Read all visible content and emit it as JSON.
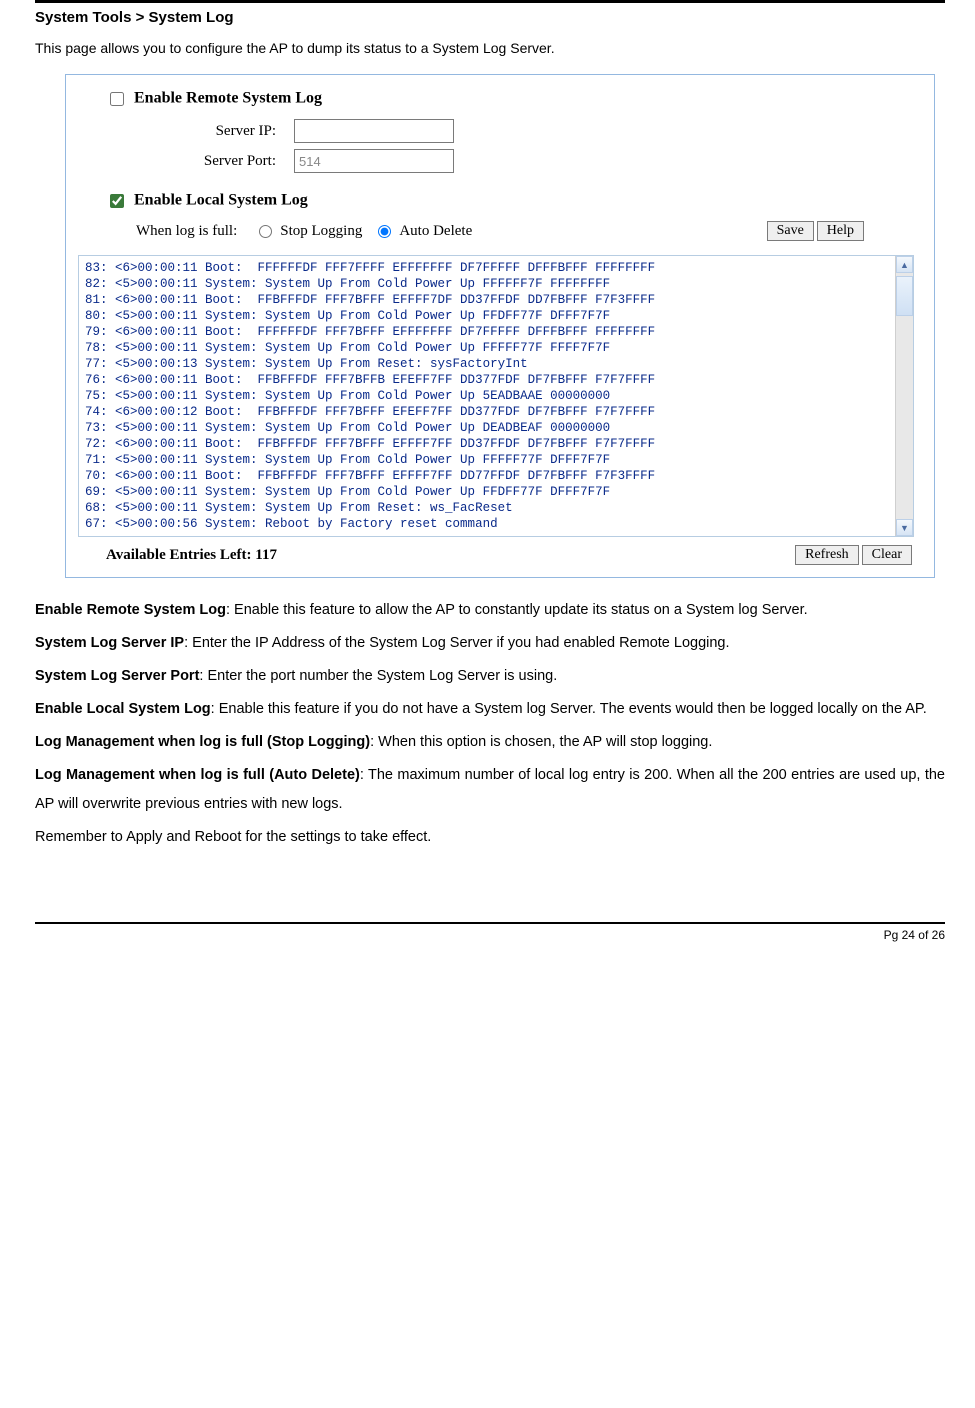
{
  "breadcrumb": "System Tools > System Log",
  "intro": "This page allows you to configure the AP to dump its status to a System Log Server.",
  "remote": {
    "heading": "Enable Remote System Log",
    "checked": false,
    "server_ip_label": "Server IP:",
    "server_ip_value": "",
    "server_port_label": "Server Port:",
    "server_port_value": "514"
  },
  "local": {
    "heading": "Enable Local System Log",
    "checked": true,
    "when_full_label": "When log is full:",
    "opt_stop": "Stop Logging",
    "opt_auto": "Auto Delete",
    "selected": "auto"
  },
  "buttons": {
    "save": "Save",
    "help": "Help",
    "refresh": "Refresh",
    "clear": "Clear"
  },
  "log_lines": [
    "83: <6>00:00:11 Boot:  FFFFFFDF FFF7FFFF EFFFFFFF DF7FFFFF DFFFBFFF FFFFFFFF",
    "82: <5>00:00:11 System: System Up From Cold Power Up FFFFFF7F FFFFFFFF",
    "81: <6>00:00:11 Boot:  FFBFFFDF FFF7BFFF EFFFF7DF DD37FFDF DD7FBFFF F7F3FFFF",
    "80: <5>00:00:11 System: System Up From Cold Power Up FFDFF77F DFFF7F7F",
    "79: <6>00:00:11 Boot:  FFFFFFDF FFF7BFFF EFFFFFFF DF7FFFFF DFFFBFFF FFFFFFFF",
    "78: <5>00:00:11 System: System Up From Cold Power Up FFFFF77F FFFF7F7F",
    "77: <5>00:00:13 System: System Up From Reset: sysFactoryInt",
    "76: <6>00:00:11 Boot:  FFBFFFDF FFF7BFFB EFEFF7FF DD377FDF DF7FBFFF F7F7FFFF",
    "75: <5>00:00:11 System: System Up From Cold Power Up 5EADBAAE 00000000",
    "74: <6>00:00:12 Boot:  FFBFFFDF FFF7BFFF EFEFF7FF DD377FDF DF7FBFFF F7F7FFFF",
    "73: <5>00:00:11 System: System Up From Cold Power Up DEADBEAF 00000000",
    "72: <6>00:00:11 Boot:  FFBFFFDF FFF7BFFF EFFFF7FF DD37FFDF DF7FBFFF F7F7FFFF",
    "71: <5>00:00:11 System: System Up From Cold Power Up FFFFF77F DFFF7F7F",
    "70: <6>00:00:11 Boot:  FFBFFFDF FFF7BFFF EFFFF7FF DD77FFDF DF7FBFFF F7F3FFFF",
    "69: <5>00:00:11 System: System Up From Cold Power Up FFDFF77F DFFF7F7F",
    "68: <5>00:00:11 System: System Up From Reset: ws_FacReset",
    "67: <5>00:00:56 System: Reboot by Factory reset command"
  ],
  "available_label": "Available Entries Left: 117",
  "descriptions": {
    "d1_b": "Enable Remote System Log",
    "d1_t": ": Enable this feature to allow the AP to constantly update its status on a System log Server.",
    "d2_b": "System Log Server IP",
    "d2_t": ": Enter the IP Address of the System Log Server if you had enabled Remote Logging.",
    "d3_b": "System Log Server Port",
    "d3_t": ": Enter the port number the System Log Server is using.",
    "d4_b": "Enable Local System Log",
    "d4_t": ": Enable this feature if you do not have a System log Server. The events would then be logged locally on the AP.",
    "d5_b": "Log Management when log is full (Stop Logging)",
    "d5_t": ": When this option is chosen, the AP will stop logging.",
    "d6_b": "Log Management when log is full (Auto Delete)",
    "d6_t": ": The maximum number of local log entry is 200. When all the 200 entries are used up, the AP will overwrite previous entries with new logs.",
    "d7_t": "Remember to Apply and Reboot for the settings to take effect."
  },
  "footer": "Pg 24 of 26"
}
